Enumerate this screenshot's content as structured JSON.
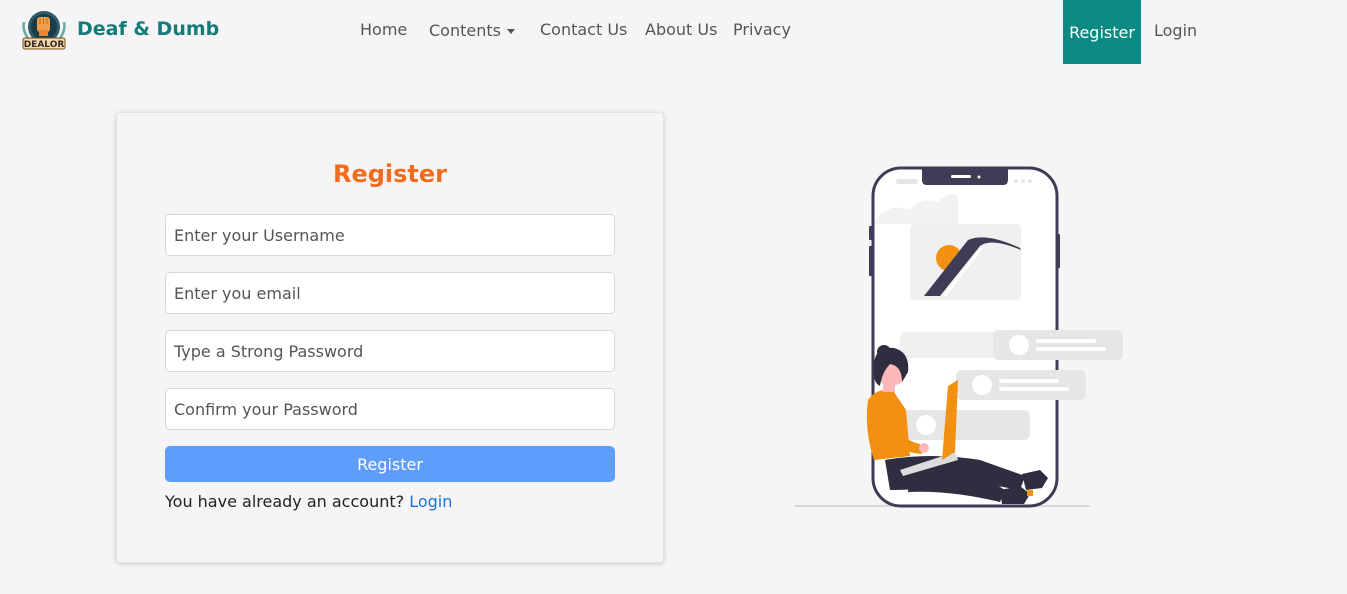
{
  "brand": {
    "name": "Deaf & Dumb",
    "logo_text": "DEALOR",
    "logo_icon": "raised-fist-logo"
  },
  "nav": {
    "home": "Home",
    "contents": "Contents",
    "contact": "Contact Us",
    "about": "About Us",
    "privacy": "Privacy",
    "register": "Register",
    "login": "Login"
  },
  "form": {
    "title": "Register",
    "username_placeholder": "Enter your Username",
    "email_placeholder": "Enter you email",
    "password_placeholder": "Type a Strong Password",
    "confirm_placeholder": "Confirm your Password",
    "submit_label": "Register",
    "account_prompt": "You have already an account?",
    "login_link": "Login"
  },
  "illustration": {
    "icon": "person-with-laptop-phone-illustration"
  },
  "colors": {
    "brand_teal": "#167a7a",
    "nav_active": "#0b8a84",
    "title_orange": "#f26c1d",
    "button_blue": "#5f9dfa",
    "link_blue": "#1a73d9"
  }
}
